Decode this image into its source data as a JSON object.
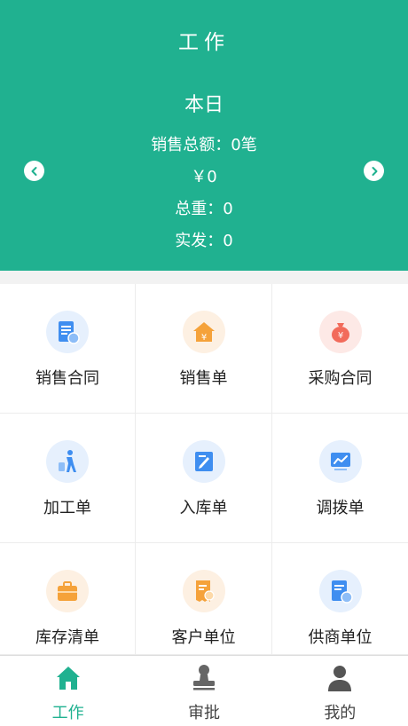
{
  "header": {
    "title": "工作",
    "period": "本日",
    "sales_total": "销售总额：0笔",
    "amount": "￥0",
    "total_weight": "总重：0",
    "shipped": "实发：0"
  },
  "colors": {
    "brand": "#20b190",
    "blue": "#3f8ef0",
    "orange": "#f5a23a",
    "red": "#f26b5b"
  },
  "grid": {
    "items": [
      {
        "label": "销售合同",
        "icon": "document-list-icon"
      },
      {
        "label": "销售单",
        "icon": "house-yen-icon"
      },
      {
        "label": "采购合同",
        "icon": "money-bag-icon"
      },
      {
        "label": "加工单",
        "icon": "walking-person-icon"
      },
      {
        "label": "入库单",
        "icon": "edit-note-icon"
      },
      {
        "label": "调拨单",
        "icon": "chart-board-icon"
      },
      {
        "label": "库存清单",
        "icon": "toolbox-icon"
      },
      {
        "label": "客户单位",
        "icon": "receipt-person-icon"
      },
      {
        "label": "供商单位",
        "icon": "supplier-document-icon"
      }
    ]
  },
  "tabbar": {
    "items": [
      {
        "label": "工作",
        "icon": "home-icon",
        "active": true
      },
      {
        "label": "审批",
        "icon": "stamp-icon",
        "active": false
      },
      {
        "label": "我的",
        "icon": "user-icon",
        "active": false
      }
    ]
  }
}
